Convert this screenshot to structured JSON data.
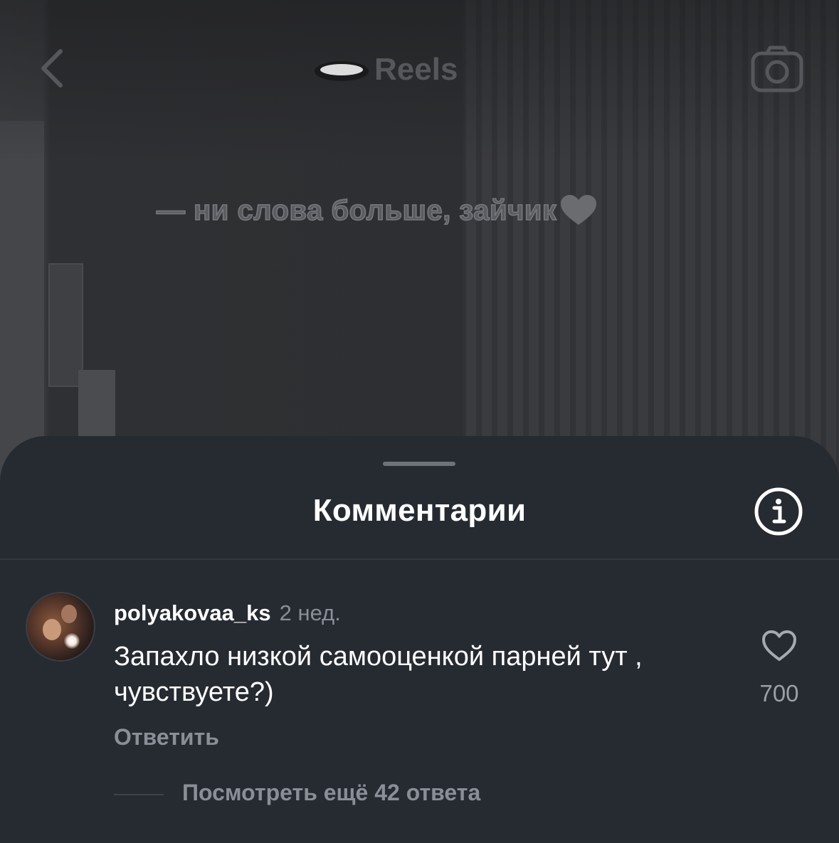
{
  "header": {
    "title": "Reels",
    "back_icon": "chevron-left-icon",
    "camera_icon": "camera-icon"
  },
  "reel": {
    "caption": "— ни слова больше, зайчик"
  },
  "comments_sheet": {
    "title": "Комментарии",
    "info_icon": "info-icon",
    "comments": [
      {
        "username": "polyakovaa_ks",
        "time": "2 нед.",
        "text": "Запахло низкой самооценкой парней тут , чувствуете?)",
        "likes": "700",
        "reply_label": "Ответить",
        "view_replies_label": "Посмотреть ещё 42 ответа"
      }
    ]
  },
  "colors": {
    "sheet_background": "#262a31",
    "secondary_text": "#8a8f97",
    "primary_text": "#ffffff"
  }
}
